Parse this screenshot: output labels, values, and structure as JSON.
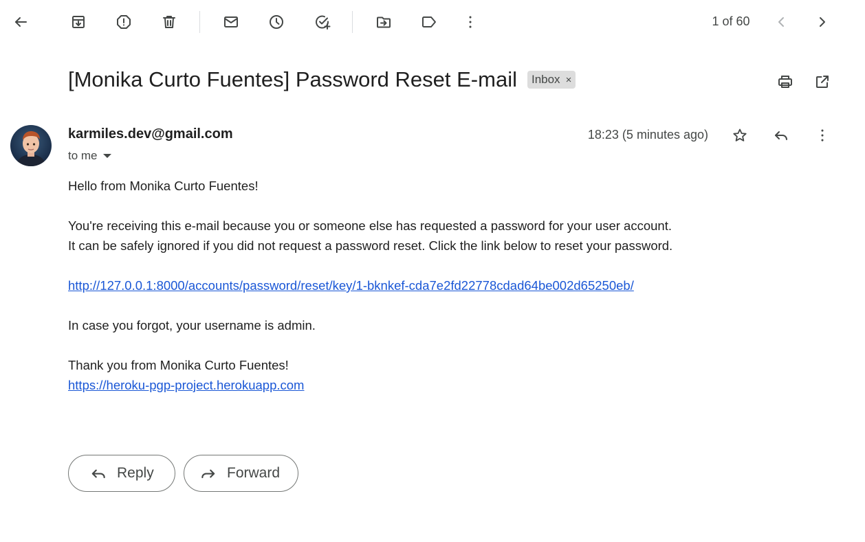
{
  "toolbar": {
    "back": "back-icon",
    "archive": "archive-icon",
    "spam": "report-spam-icon",
    "delete": "delete-icon",
    "mark_unread": "mark-unread-icon",
    "snooze": "snooze-icon",
    "add_task": "add-to-tasks-icon",
    "move_to": "move-to-icon",
    "labels": "label-icon",
    "more": "more-icon"
  },
  "pager": {
    "text": "1 of 60"
  },
  "email": {
    "subject": "[Monika Curto Fuentes] Password Reset E-mail",
    "label": "Inbox",
    "label_remove": "×",
    "sender": "karmiles.dev@gmail.com",
    "recipient": "to me",
    "timestamp": "18:23 (5 minutes ago)",
    "body": {
      "greeting": "Hello from Monika Curto Fuentes!",
      "line1": "You're receiving this e-mail because you or someone else has requested a password for your user account.",
      "line2": "It can be safely ignored if you did not request a password reset. Click the link below to reset your password.",
      "reset_link": "http://127.0.0.1:8000/accounts/password/reset/key/1-bknkef-cda7e2fd22778cdad64be002d65250eb/",
      "username_note": "In case you forgot, your username is admin.",
      "thanks": "Thank you from Monika Curto Fuentes!",
      "site_link": "https://heroku-pgp-project.herokuapp.com"
    }
  },
  "actions": {
    "reply": "Reply",
    "forward": "Forward"
  },
  "colors": {
    "link": "#1a57d6",
    "chip_bg": "#dddddd",
    "icon": "#444746"
  }
}
